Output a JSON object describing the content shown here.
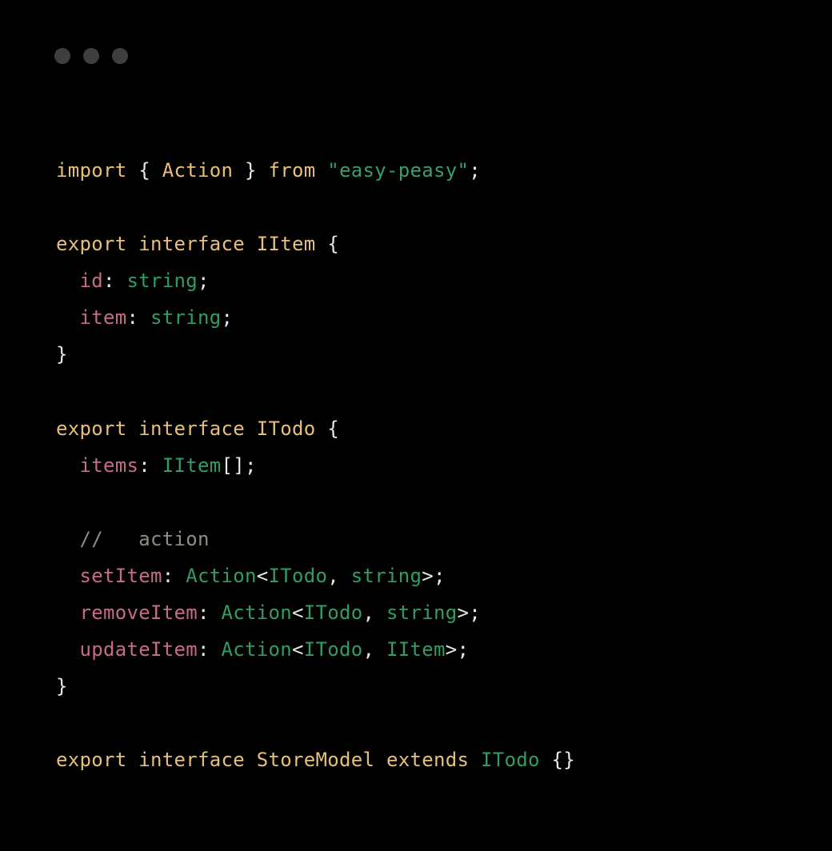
{
  "colors": {
    "keyword": "#e6c07b",
    "type": "#2f9e63",
    "string": "#3a9e6a",
    "property": "#c96a87",
    "comment": "#8e8e83",
    "punctuation": "#e8e8e8",
    "background": "#000000"
  },
  "code": {
    "lines": [
      {
        "tokens": [
          {
            "t": "import ",
            "c": "kw"
          },
          {
            "t": "{ ",
            "c": "punc"
          },
          {
            "t": "Action",
            "c": "ident"
          },
          {
            "t": " } ",
            "c": "punc"
          },
          {
            "t": "from ",
            "c": "kw"
          },
          {
            "t": "\"easy-peasy\"",
            "c": "str"
          },
          {
            "t": ";",
            "c": "punc"
          }
        ]
      },
      {
        "tokens": []
      },
      {
        "tokens": [
          {
            "t": "export ",
            "c": "kw"
          },
          {
            "t": "interface ",
            "c": "kw"
          },
          {
            "t": "IItem",
            "c": "ident"
          },
          {
            "t": " {",
            "c": "punc"
          }
        ]
      },
      {
        "tokens": [
          {
            "t": "  ",
            "c": "ws"
          },
          {
            "t": "id",
            "c": "prop"
          },
          {
            "t": ": ",
            "c": "punc"
          },
          {
            "t": "string",
            "c": "type"
          },
          {
            "t": ";",
            "c": "punc"
          }
        ]
      },
      {
        "tokens": [
          {
            "t": "  ",
            "c": "ws"
          },
          {
            "t": "item",
            "c": "prop"
          },
          {
            "t": ": ",
            "c": "punc"
          },
          {
            "t": "string",
            "c": "type"
          },
          {
            "t": ";",
            "c": "punc"
          }
        ]
      },
      {
        "tokens": [
          {
            "t": "}",
            "c": "punc"
          }
        ]
      },
      {
        "tokens": []
      },
      {
        "tokens": [
          {
            "t": "export ",
            "c": "kw"
          },
          {
            "t": "interface ",
            "c": "kw"
          },
          {
            "t": "ITodo",
            "c": "ident"
          },
          {
            "t": " {",
            "c": "punc"
          }
        ]
      },
      {
        "tokens": [
          {
            "t": "  ",
            "c": "ws"
          },
          {
            "t": "items",
            "c": "prop"
          },
          {
            "t": ": ",
            "c": "punc"
          },
          {
            "t": "IItem",
            "c": "type"
          },
          {
            "t": "[];",
            "c": "punc"
          }
        ]
      },
      {
        "tokens": []
      },
      {
        "tokens": [
          {
            "t": "  ",
            "c": "ws"
          },
          {
            "t": "//   action",
            "c": "cmt"
          }
        ]
      },
      {
        "tokens": [
          {
            "t": "  ",
            "c": "ws"
          },
          {
            "t": "setItem",
            "c": "prop"
          },
          {
            "t": ": ",
            "c": "punc"
          },
          {
            "t": "Action",
            "c": "type"
          },
          {
            "t": "<",
            "c": "punc"
          },
          {
            "t": "ITodo",
            "c": "type"
          },
          {
            "t": ", ",
            "c": "punc"
          },
          {
            "t": "string",
            "c": "type"
          },
          {
            "t": ">;",
            "c": "punc"
          }
        ]
      },
      {
        "tokens": [
          {
            "t": "  ",
            "c": "ws"
          },
          {
            "t": "removeItem",
            "c": "prop"
          },
          {
            "t": ": ",
            "c": "punc"
          },
          {
            "t": "Action",
            "c": "type"
          },
          {
            "t": "<",
            "c": "punc"
          },
          {
            "t": "ITodo",
            "c": "type"
          },
          {
            "t": ", ",
            "c": "punc"
          },
          {
            "t": "string",
            "c": "type"
          },
          {
            "t": ">;",
            "c": "punc"
          }
        ]
      },
      {
        "tokens": [
          {
            "t": "  ",
            "c": "ws"
          },
          {
            "t": "updateItem",
            "c": "prop"
          },
          {
            "t": ": ",
            "c": "punc"
          },
          {
            "t": "Action",
            "c": "type"
          },
          {
            "t": "<",
            "c": "punc"
          },
          {
            "t": "ITodo",
            "c": "type"
          },
          {
            "t": ", ",
            "c": "punc"
          },
          {
            "t": "IItem",
            "c": "type"
          },
          {
            "t": ">;",
            "c": "punc"
          }
        ]
      },
      {
        "tokens": [
          {
            "t": "}",
            "c": "punc"
          }
        ]
      },
      {
        "tokens": []
      },
      {
        "tokens": [
          {
            "t": "export ",
            "c": "kw"
          },
          {
            "t": "interface ",
            "c": "kw"
          },
          {
            "t": "StoreModel",
            "c": "ident"
          },
          {
            "t": " extends ",
            "c": "kw"
          },
          {
            "t": "ITodo",
            "c": "type"
          },
          {
            "t": " {}",
            "c": "punc"
          }
        ]
      }
    ]
  }
}
